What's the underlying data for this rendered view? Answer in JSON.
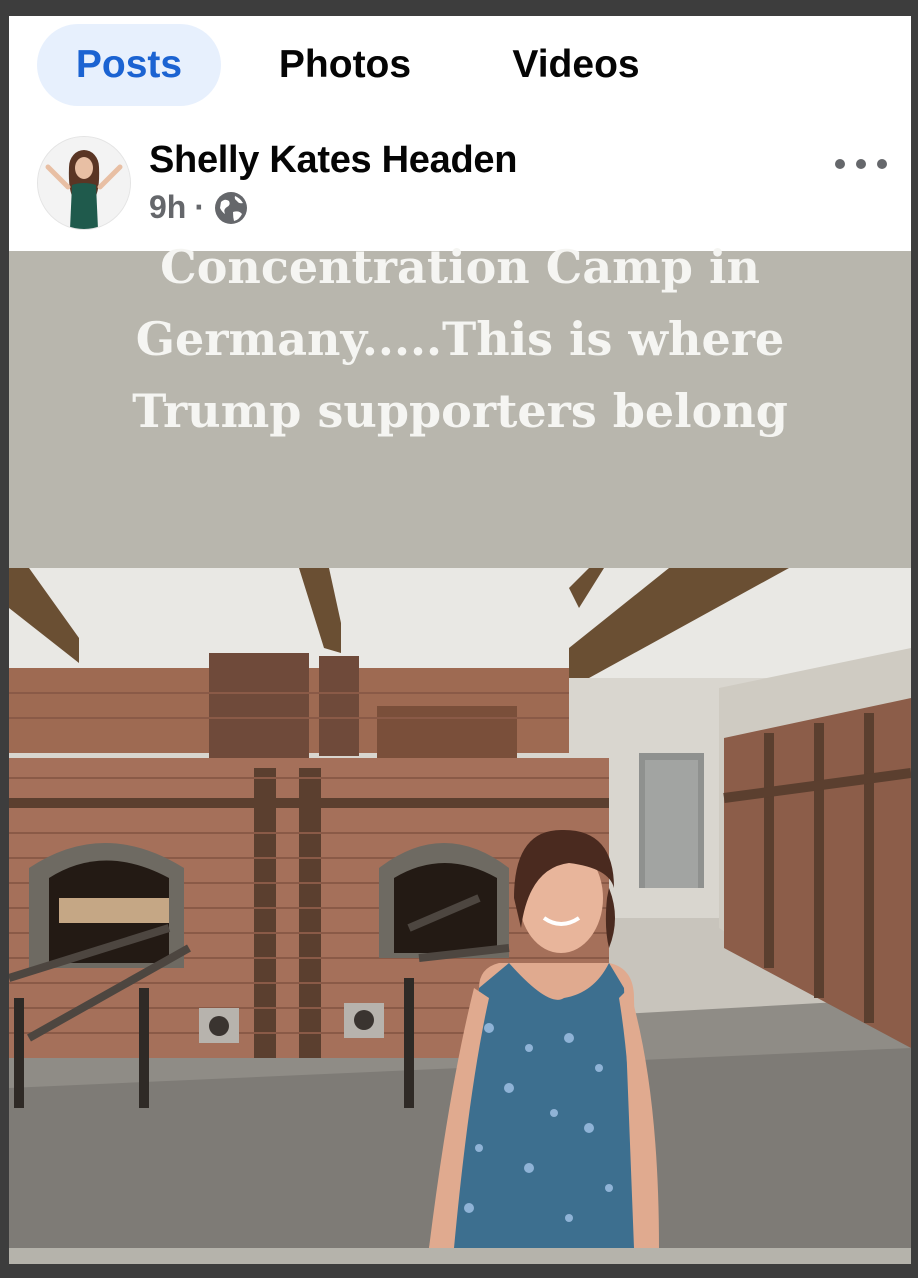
{
  "tabs": [
    {
      "label": "Posts",
      "active": true
    },
    {
      "label": "Photos",
      "active": false
    },
    {
      "label": "Videos",
      "active": false
    }
  ],
  "post": {
    "author": "Shelly Kates Headen",
    "time": "9h",
    "separator": "·",
    "privacy_icon": "globe-icon",
    "more_icon": "more-options-icon",
    "overlay_lines": [
      "Concentration Camp in",
      "Germany.....This is where",
      "Trump supporters belong"
    ]
  },
  "colors": {
    "accent": "#1b63d2",
    "active_tab_bg": "#e7f0fd",
    "secondary_text": "#65676b",
    "text_panel_bg": "#b8b6ad"
  }
}
